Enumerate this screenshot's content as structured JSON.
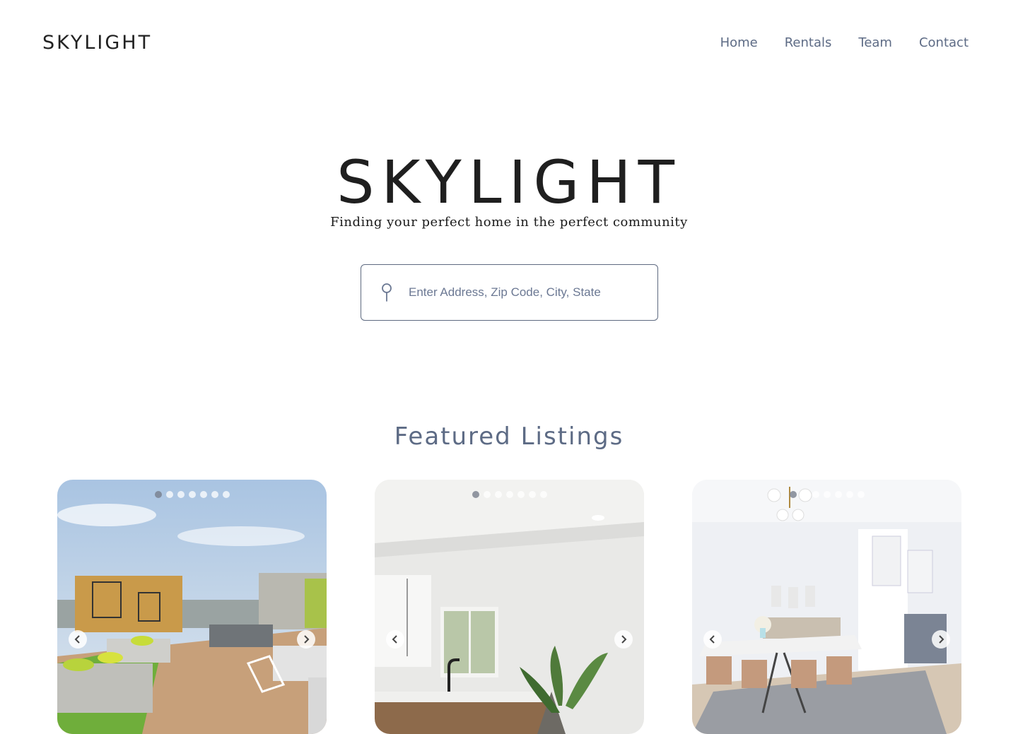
{
  "header": {
    "logo": "SKYLIGHT",
    "nav": [
      "Home",
      "Rentals",
      "Team",
      "Contact"
    ]
  },
  "hero": {
    "title": "SKYLIGHT",
    "tagline": "Finding your perfect home in the perfect community"
  },
  "search": {
    "icon": "map-pin-icon",
    "placeholder": "Enter Address, Zip Code, City, State"
  },
  "featured": {
    "title": "Featured Listings",
    "listings": [
      {
        "image": "rooftop-terrace",
        "dots": 7,
        "active_dot": 0
      },
      {
        "image": "kitchen-interior",
        "dots": 7,
        "active_dot": 0
      },
      {
        "image": "dining-room",
        "dots": 7,
        "active_dot": 0
      }
    ]
  },
  "colors": {
    "nav_text": "#5d6b85",
    "title_text": "#1f1f1f",
    "search_border": "#5e6a80"
  }
}
